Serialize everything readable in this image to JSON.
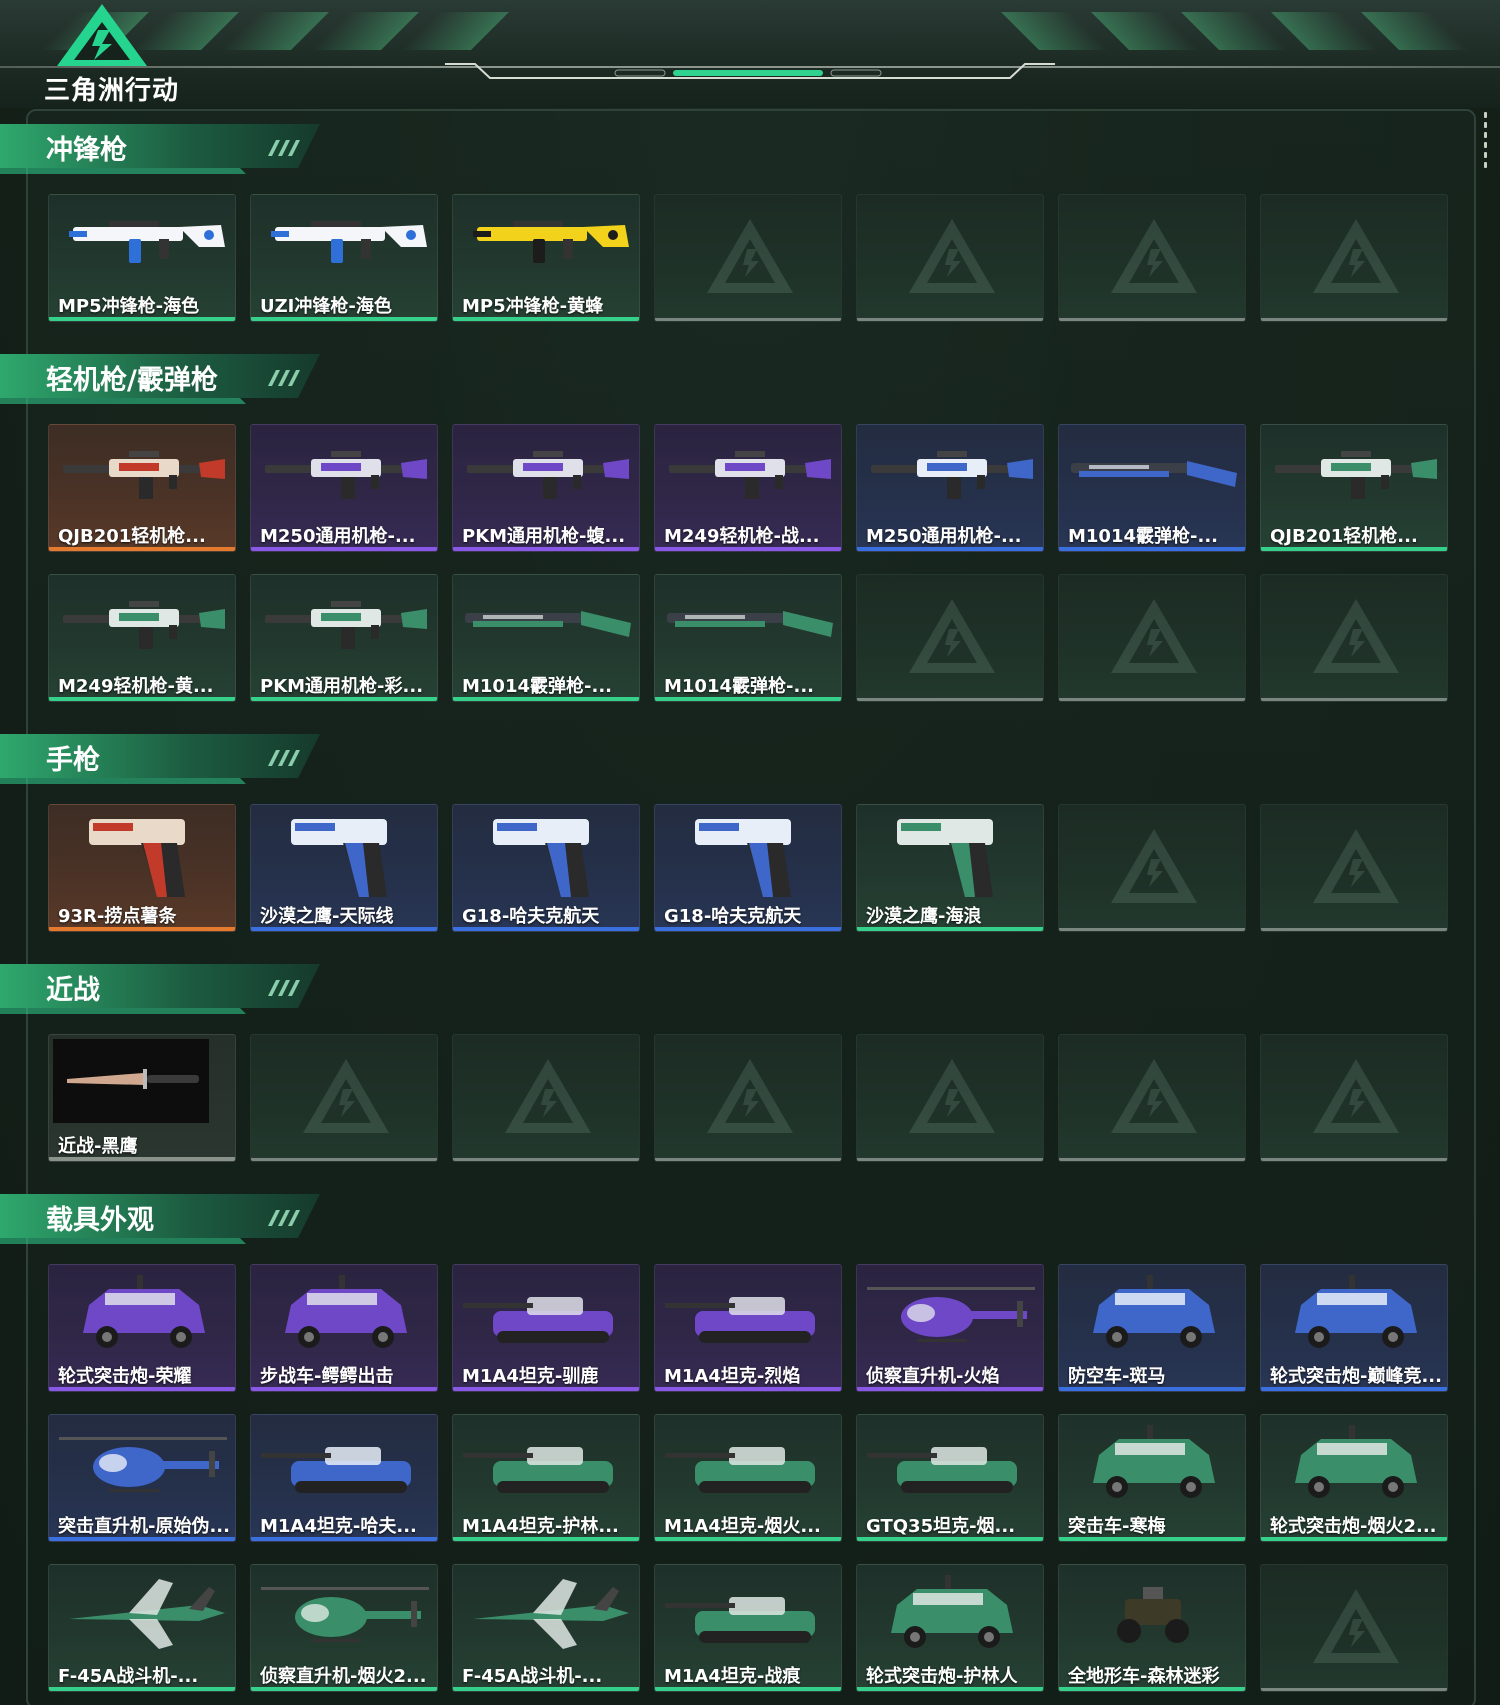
{
  "header": {
    "logo_text": "三角洲行动"
  },
  "sections": [
    {
      "title": "冲锋枪",
      "rows": [
        [
          {
            "name": "MP5冲锋枪-海色",
            "quality": "green",
            "kind": "smg"
          },
          {
            "name": "UZI冲锋枪-海色",
            "quality": "green",
            "kind": "uzi"
          },
          {
            "name": "MP5冲锋枪-黄蜂",
            "quality": "green",
            "kind": "smg-yellow"
          },
          null,
          null,
          null,
          null
        ]
      ]
    },
    {
      "title": "轻机枪/霰弹枪",
      "rows": [
        [
          {
            "name": "QJB201轻机枪...",
            "quality": "orange",
            "kind": "lmg"
          },
          {
            "name": "M250通用机枪-...",
            "quality": "purple",
            "kind": "mg"
          },
          {
            "name": "PKM通用机枪-蝮...",
            "quality": "purple",
            "kind": "mg"
          },
          {
            "name": "M249轻机枪-战...",
            "quality": "purple",
            "kind": "lmg"
          },
          {
            "name": "M250通用机枪-...",
            "quality": "blue",
            "kind": "mg"
          },
          {
            "name": "M1014霰弹枪-...",
            "quality": "blue",
            "kind": "shotgun"
          },
          {
            "name": "QJB201轻机枪...",
            "quality": "green",
            "kind": "lmg"
          }
        ],
        [
          {
            "name": "M249轻机枪-黄...",
            "quality": "green",
            "kind": "mg"
          },
          {
            "name": "PKM通用机枪-彩...",
            "quality": "green",
            "kind": "mg"
          },
          {
            "name": "M1014霰弹枪-...",
            "quality": "green",
            "kind": "shotgun"
          },
          {
            "name": "M1014霰弹枪-...",
            "quality": "green",
            "kind": "shotgun"
          },
          null,
          null,
          null
        ]
      ]
    },
    {
      "title": "手枪",
      "rows": [
        [
          {
            "name": "93R-捞点薯条",
            "quality": "orange",
            "kind": "pistol"
          },
          {
            "name": "沙漠之鹰-天际线",
            "quality": "blue",
            "kind": "pistol"
          },
          {
            "name": "G18-哈夫克航天",
            "quality": "blue",
            "kind": "pistol"
          },
          {
            "name": "G18-哈夫克航天",
            "quality": "blue",
            "kind": "pistol"
          },
          {
            "name": "沙漠之鹰-海浪",
            "quality": "green",
            "kind": "pistol"
          },
          null,
          null
        ]
      ]
    },
    {
      "title": "近战",
      "rows": [
        [
          {
            "name": "近战-黑鹰",
            "quality": "gray",
            "kind": "knife"
          },
          null,
          null,
          null,
          null,
          null,
          null
        ]
      ]
    },
    {
      "title": "载具外观",
      "rows": [
        [
          {
            "name": "轮式突击炮-荣耀",
            "quality": "purple",
            "kind": "car"
          },
          {
            "name": "步战车-鳄鳄出击",
            "quality": "purple",
            "kind": "apc"
          },
          {
            "name": "M1A4坦克-驯鹿",
            "quality": "purple",
            "kind": "tank"
          },
          {
            "name": "M1A4坦克-烈焰",
            "quality": "purple",
            "kind": "tank"
          },
          {
            "name": "侦察直升机-火焰",
            "quality": "purple",
            "kind": "heli"
          },
          {
            "name": "防空车-斑马",
            "quality": "blue",
            "kind": "apc"
          },
          {
            "name": "轮式突击炮-巅峰竞...",
            "quality": "blue",
            "kind": "car"
          }
        ],
        [
          {
            "name": "突击直升机-原始伪...",
            "quality": "blue",
            "kind": "heli"
          },
          {
            "name": "M1A4坦克-哈夫...",
            "quality": "blue",
            "kind": "tank"
          },
          {
            "name": "M1A4坦克-护林...",
            "quality": "green",
            "kind": "tank"
          },
          {
            "name": "M1A4坦克-烟火...",
            "quality": "green",
            "kind": "tank"
          },
          {
            "name": "GTQ35坦克-烟...",
            "quality": "green",
            "kind": "tank"
          },
          {
            "name": "突击车-寒梅",
            "quality": "green",
            "kind": "car"
          },
          {
            "name": "轮式突击炮-烟火2...",
            "quality": "green",
            "kind": "car"
          }
        ],
        [
          {
            "name": "F-45A战斗机-...",
            "quality": "green",
            "kind": "jet"
          },
          {
            "name": "侦察直升机-烟火2...",
            "quality": "green",
            "kind": "heli"
          },
          {
            "name": "F-45A战斗机-...",
            "quality": "green",
            "kind": "jet"
          },
          {
            "name": "M1A4坦克-战痕",
            "quality": "green",
            "kind": "tank"
          },
          {
            "name": "轮式突击炮-护林人",
            "quality": "green",
            "kind": "car"
          },
          {
            "name": "全地形车-森林迷彩",
            "quality": "green",
            "kind": "atv"
          },
          null
        ]
      ]
    }
  ],
  "colors": {
    "orange": "#e37a2e",
    "purple": "#8a58e6",
    "blue": "#3a6fe0",
    "green": "#35d08a",
    "accent": "#2fd28f"
  }
}
